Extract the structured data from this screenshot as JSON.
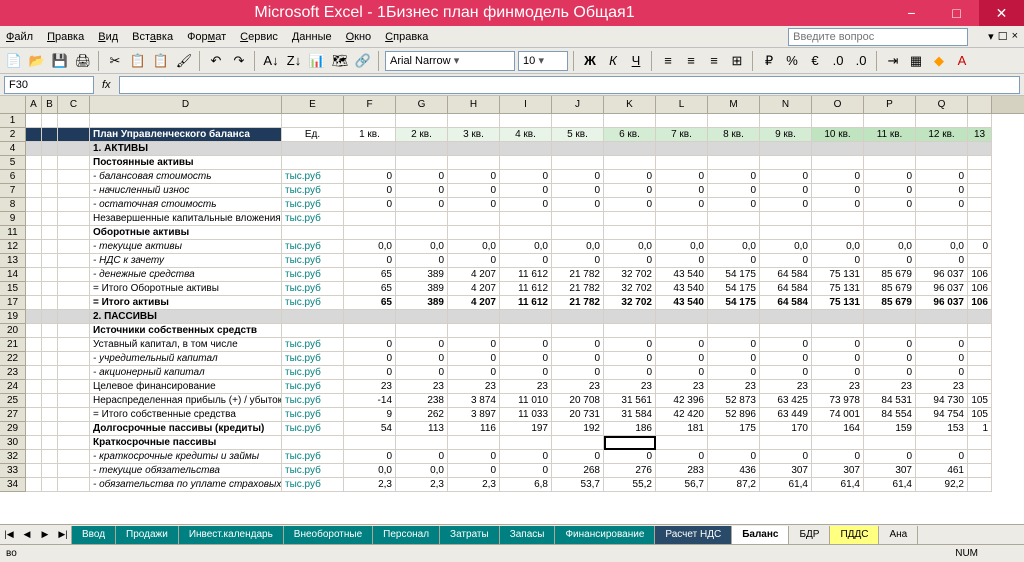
{
  "title": "Microsoft Excel - 1Бизнес план финмодель Общая1",
  "menu": [
    "Файл",
    "Правка",
    "Вид",
    "Вставка",
    "Формат",
    "Сервис",
    "Данные",
    "Окно",
    "Справка"
  ],
  "ask_placeholder": "Введите вопрос",
  "font_name": "Arial Narrow",
  "font_size": "10",
  "namebox": "F30",
  "columns": [
    {
      "l": "",
      "w": 26
    },
    {
      "l": "A",
      "w": 16
    },
    {
      "l": "B",
      "w": 16
    },
    {
      "l": "C",
      "w": 32
    },
    {
      "l": "D",
      "w": 192
    },
    {
      "l": "E",
      "w": 62
    },
    {
      "l": "F",
      "w": 52
    },
    {
      "l": "G",
      "w": 52
    },
    {
      "l": "H",
      "w": 52
    },
    {
      "l": "I",
      "w": 52
    },
    {
      "l": "J",
      "w": 52
    },
    {
      "l": "K",
      "w": 52
    },
    {
      "l": "L",
      "w": 52
    },
    {
      "l": "M",
      "w": 52
    },
    {
      "l": "N",
      "w": 52
    },
    {
      "l": "O",
      "w": 52
    },
    {
      "l": "P",
      "w": 52
    },
    {
      "l": "Q",
      "w": 52
    },
    {
      "l": "",
      "w": 24
    }
  ],
  "header_row": {
    "title": "План Управленческого баланса",
    "unit": "Ед.",
    "quarters": [
      "1 кв.",
      "2 кв.",
      "3 кв.",
      "4 кв.",
      "5 кв.",
      "6 кв.",
      "7 кв.",
      "8 кв.",
      "9 кв.",
      "10 кв.",
      "11 кв.",
      "12 кв.",
      "13"
    ]
  },
  "rows": [
    {
      "n": 4,
      "type": "gray",
      "label": "1. АКТИВЫ",
      "bold": true
    },
    {
      "n": 5,
      "type": "text",
      "label": "Постоянные активы",
      "bold": true,
      "indent": 1
    },
    {
      "n": 6,
      "type": "data",
      "label": "- балансовая стоимость",
      "ital": true,
      "indent": 3,
      "unit": "тыс.руб",
      "vals": [
        "0",
        "0",
        "0",
        "0",
        "0",
        "0",
        "0",
        "0",
        "0",
        "0",
        "0",
        "0",
        ""
      ]
    },
    {
      "n": 7,
      "type": "data",
      "label": "- начисленный износ",
      "ital": true,
      "indent": 3,
      "unit": "тыс.руб",
      "vals": [
        "0",
        "0",
        "0",
        "0",
        "0",
        "0",
        "0",
        "0",
        "0",
        "0",
        "0",
        "0",
        ""
      ]
    },
    {
      "n": 8,
      "type": "data",
      "label": "- остаточная стоимость",
      "ital": true,
      "indent": 3,
      "unit": "тыс.руб",
      "vals": [
        "0",
        "0",
        "0",
        "0",
        "0",
        "0",
        "0",
        "0",
        "0",
        "0",
        "0",
        "0",
        ""
      ]
    },
    {
      "n": 9,
      "type": "data",
      "label": "Незавершенные капитальные вложения",
      "indent": 1,
      "unit": "тыс.руб",
      "vals": [
        "",
        "",
        "",
        "",
        "",
        "",
        "",
        "",
        "",
        "",
        "",
        "",
        ""
      ]
    },
    {
      "n": 11,
      "type": "text",
      "label": "Оборотные активы",
      "bold": true,
      "indent": 1
    },
    {
      "n": 12,
      "type": "data",
      "label": "- текущие активы",
      "ital": true,
      "indent": 3,
      "unit": "тыс.руб",
      "vals": [
        "0,0",
        "0,0",
        "0,0",
        "0,0",
        "0,0",
        "0,0",
        "0,0",
        "0,0",
        "0,0",
        "0,0",
        "0,0",
        "0,0",
        "0"
      ]
    },
    {
      "n": 13,
      "type": "data",
      "label": "- НДС к зачету",
      "ital": true,
      "indent": 3,
      "unit": "тыс.руб",
      "vals": [
        "0",
        "0",
        "0",
        "0",
        "0",
        "0",
        "0",
        "0",
        "0",
        "0",
        "0",
        "0",
        ""
      ]
    },
    {
      "n": 14,
      "type": "data",
      "label": "- денежные средства",
      "ital": true,
      "indent": 3,
      "unit": "тыс.руб",
      "vals": [
        "65",
        "389",
        "4 207",
        "11 612",
        "21 782",
        "32 702",
        "43 540",
        "54 175",
        "64 584",
        "75 131",
        "85 679",
        "96 037",
        "106"
      ]
    },
    {
      "n": 15,
      "type": "data",
      "label": "= Итого Оборотные активы",
      "indent": 1,
      "unit": "тыс.руб",
      "vals": [
        "65",
        "389",
        "4 207",
        "11 612",
        "21 782",
        "32 702",
        "43 540",
        "54 175",
        "64 584",
        "75 131",
        "85 679",
        "96 037",
        "106"
      ]
    },
    {
      "n": 17,
      "type": "data",
      "label": "= Итого активы",
      "bold": true,
      "indent": 1,
      "unit": "тыс.руб",
      "vals": [
        "65",
        "389",
        "4 207",
        "11 612",
        "21 782",
        "32 702",
        "43 540",
        "54 175",
        "64 584",
        "75 131",
        "85 679",
        "96 037",
        "106"
      ],
      "bvals": true
    },
    {
      "n": 19,
      "type": "gray",
      "label": "2. ПАССИВЫ",
      "bold": true
    },
    {
      "n": 20,
      "type": "text",
      "label": "Источники собственных средств",
      "bold": true,
      "indent": 1
    },
    {
      "n": 21,
      "type": "data",
      "label": "Уставный капитал, в том числе",
      "indent": 1,
      "unit": "тыс.руб",
      "vals": [
        "0",
        "0",
        "0",
        "0",
        "0",
        "0",
        "0",
        "0",
        "0",
        "0",
        "0",
        "0",
        ""
      ]
    },
    {
      "n": 22,
      "type": "data",
      "label": "- учредительный капитал",
      "ital": true,
      "indent": 3,
      "unit": "тыс.руб",
      "vals": [
        "0",
        "0",
        "0",
        "0",
        "0",
        "0",
        "0",
        "0",
        "0",
        "0",
        "0",
        "0",
        ""
      ]
    },
    {
      "n": 23,
      "type": "data",
      "label": "- акционерный капитал",
      "ital": true,
      "indent": 3,
      "unit": "тыс.руб",
      "vals": [
        "0",
        "0",
        "0",
        "0",
        "0",
        "0",
        "0",
        "0",
        "0",
        "0",
        "0",
        "0",
        ""
      ]
    },
    {
      "n": 24,
      "type": "data",
      "label": "Целевое финансирование",
      "indent": 1,
      "unit": "тыс.руб",
      "vals": [
        "23",
        "23",
        "23",
        "23",
        "23",
        "23",
        "23",
        "23",
        "23",
        "23",
        "23",
        "23",
        ""
      ]
    },
    {
      "n": 25,
      "type": "data",
      "label": "Нераспределенная прибыль (+) / убыток (-)",
      "indent": 1,
      "unit": "тыс.руб",
      "vals": [
        "-14",
        "238",
        "3 874",
        "11 010",
        "20 708",
        "31 561",
        "42 396",
        "52 873",
        "63 425",
        "73 978",
        "84 531",
        "94 730",
        "105"
      ]
    },
    {
      "n": 27,
      "type": "data",
      "label": "= Итого собственные средства",
      "indent": 1,
      "unit": "тыс.руб",
      "vals": [
        "9",
        "262",
        "3 897",
        "11 033",
        "20 731",
        "31 584",
        "42 420",
        "52 896",
        "63 449",
        "74 001",
        "84 554",
        "94 754",
        "105"
      ]
    },
    {
      "n": 29,
      "type": "data",
      "label": "Долгосрочные пассивы (кредиты)",
      "bold": true,
      "indent": 1,
      "unit": "тыс.руб",
      "vals": [
        "54",
        "113",
        "116",
        "197",
        "192",
        "186",
        "181",
        "175",
        "170",
        "164",
        "159",
        "153",
        "1"
      ]
    },
    {
      "n": 30,
      "type": "text",
      "label": "Краткосрочные пассивы",
      "bold": true,
      "indent": 1,
      "sel_col": 5
    },
    {
      "n": 32,
      "type": "data",
      "label": "- краткосрочные кредиты и займы",
      "ital": true,
      "indent": 3,
      "unit": "тыс.руб",
      "vals": [
        "0",
        "0",
        "0",
        "0",
        "0",
        "0",
        "0",
        "0",
        "0",
        "0",
        "0",
        "0",
        ""
      ]
    },
    {
      "n": 33,
      "type": "data",
      "label": "- текущие обязательства",
      "ital": true,
      "indent": 3,
      "unit": "тыс.руб",
      "vals": [
        "0,0",
        "0,0",
        "0",
        "0",
        "268",
        "276",
        "283",
        "436",
        "307",
        "307",
        "307",
        "461",
        ""
      ]
    },
    {
      "n": 34,
      "type": "data",
      "label": "- обязательства по уплате страховых взносов",
      "ital": true,
      "indent": 3,
      "unit": "тыс.руб",
      "vals": [
        "2,3",
        "2,3",
        "2,3",
        "6,8",
        "53,7",
        "55,2",
        "56,7",
        "87,2",
        "61,4",
        "61,4",
        "61,4",
        "92,2",
        ""
      ]
    }
  ],
  "tabs": [
    {
      "l": "Ввод",
      "c": "teal"
    },
    {
      "l": "Продажи",
      "c": "teal"
    },
    {
      "l": "Инвест.календарь",
      "c": "teal"
    },
    {
      "l": "Внеоборотные",
      "c": "teal"
    },
    {
      "l": "Персонал",
      "c": "teal"
    },
    {
      "l": "Затраты",
      "c": "teal"
    },
    {
      "l": "Запасы",
      "c": "teal"
    },
    {
      "l": "Финансирование",
      "c": "teal"
    },
    {
      "l": "Расчет НДС",
      "c": "dark"
    },
    {
      "l": "Баланс",
      "c": "active"
    },
    {
      "l": "БДР",
      "c": ""
    },
    {
      "l": "ПДДС",
      "c": "yellow"
    },
    {
      "l": "Ана",
      "c": ""
    }
  ],
  "status_left": "во",
  "status_right": "NUM"
}
